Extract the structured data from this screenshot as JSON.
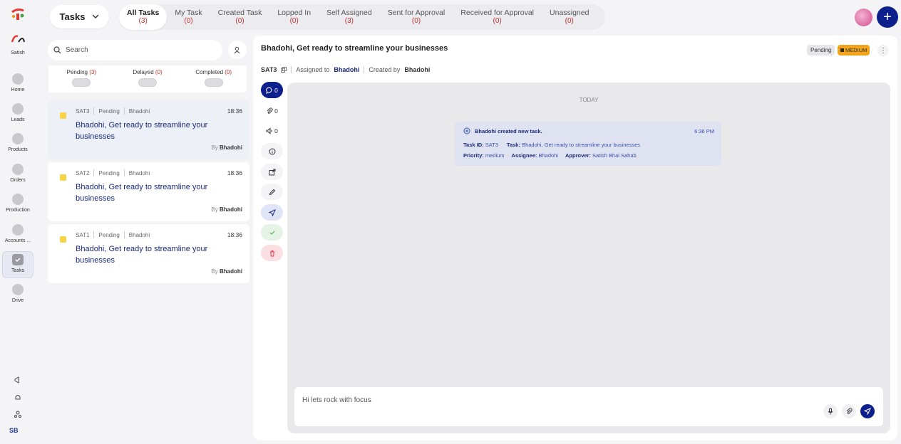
{
  "rail": {
    "user_name": "Satish",
    "items": [
      {
        "label": "Home",
        "icon": "home-icon"
      },
      {
        "label": "Leads",
        "icon": "users-icon"
      },
      {
        "label": "Products",
        "icon": "box-icon"
      },
      {
        "label": "Orders",
        "icon": "clipboard-icon"
      },
      {
        "label": "Production",
        "icon": "gear-icon"
      },
      {
        "label": "Accounts ...",
        "icon": "wallet-icon"
      },
      {
        "label": "Tasks",
        "icon": "check-icon"
      },
      {
        "label": "Drive",
        "icon": "upload-icon"
      }
    ],
    "initials": "SB"
  },
  "header": {
    "module": "Tasks",
    "tabs": [
      {
        "label": "All Tasks",
        "count": "(3)"
      },
      {
        "label": "My Task",
        "count": "(0)"
      },
      {
        "label": "Created Task",
        "count": "(0)"
      },
      {
        "label": "Lopped In",
        "count": "(0)"
      },
      {
        "label": "Self Assigned",
        "count": "(3)"
      },
      {
        "label": "Sent for Approval",
        "count": "(0)"
      },
      {
        "label": "Received for Approval",
        "count": "(0)"
      },
      {
        "label": "Unassigned",
        "count": "(0)"
      }
    ],
    "plus": "+"
  },
  "list": {
    "search_placeholder": "Search",
    "filters": [
      {
        "label": "Pending",
        "count": "(3)"
      },
      {
        "label": "Delayed",
        "count": "(0)"
      },
      {
        "label": "Completed",
        "count": "(0)"
      }
    ],
    "cards": [
      {
        "id": "SAT3",
        "status": "Pending",
        "owner": "Bhadohi",
        "time": "18:36",
        "title": "Bhadohi, Get ready to streamline your businesses",
        "by_prefix": "By",
        "by": "Bhadohi"
      },
      {
        "id": "SAT2",
        "status": "Pending",
        "owner": "Bhadohi",
        "time": "18:36",
        "title": "Bhadohi, Get ready to streamline your businesses",
        "by_prefix": "By",
        "by": "Bhadohi"
      },
      {
        "id": "SAT1",
        "status": "Pending",
        "owner": "Bhadohi",
        "time": "18:36",
        "title": "Bhadohi, Get ready to streamline your businesses",
        "by_prefix": "By",
        "by": "Bhadohi"
      }
    ]
  },
  "detail": {
    "title": "Bhadohi, Get ready to streamline your businesses",
    "status": "Pending",
    "priority": "MEDIUM",
    "more": "⋮",
    "task_id": "SAT3",
    "assigned_label": "Assigned to",
    "assigned_to": "Bhadohi",
    "created_label": "Created by",
    "created_by": "Bhadohi",
    "side_counts": {
      "comments": "0",
      "attachments": "0",
      "voice": "0"
    },
    "chat": {
      "day": "TODAY",
      "message": {
        "header": "Bhadohi created new task.",
        "time": "6:36 PM",
        "task_id_label": "Task ID:",
        "task_id": "SAT3",
        "task_label": "Task:",
        "task": "Bhadohi, Get ready to streamline your businesses",
        "priority_label": "Priority:",
        "priority": "medium",
        "assignee_label": "Assignee:",
        "assignee": "Bhadohi",
        "approver_label": "Approver:",
        "approver": "Satish Bhai Sahab"
      },
      "composer_text": "Hi lets rock with focus"
    }
  },
  "colors": {
    "brand": "#0d1f8a",
    "count_red": "#c0322f",
    "priority": "#f2a51c"
  }
}
